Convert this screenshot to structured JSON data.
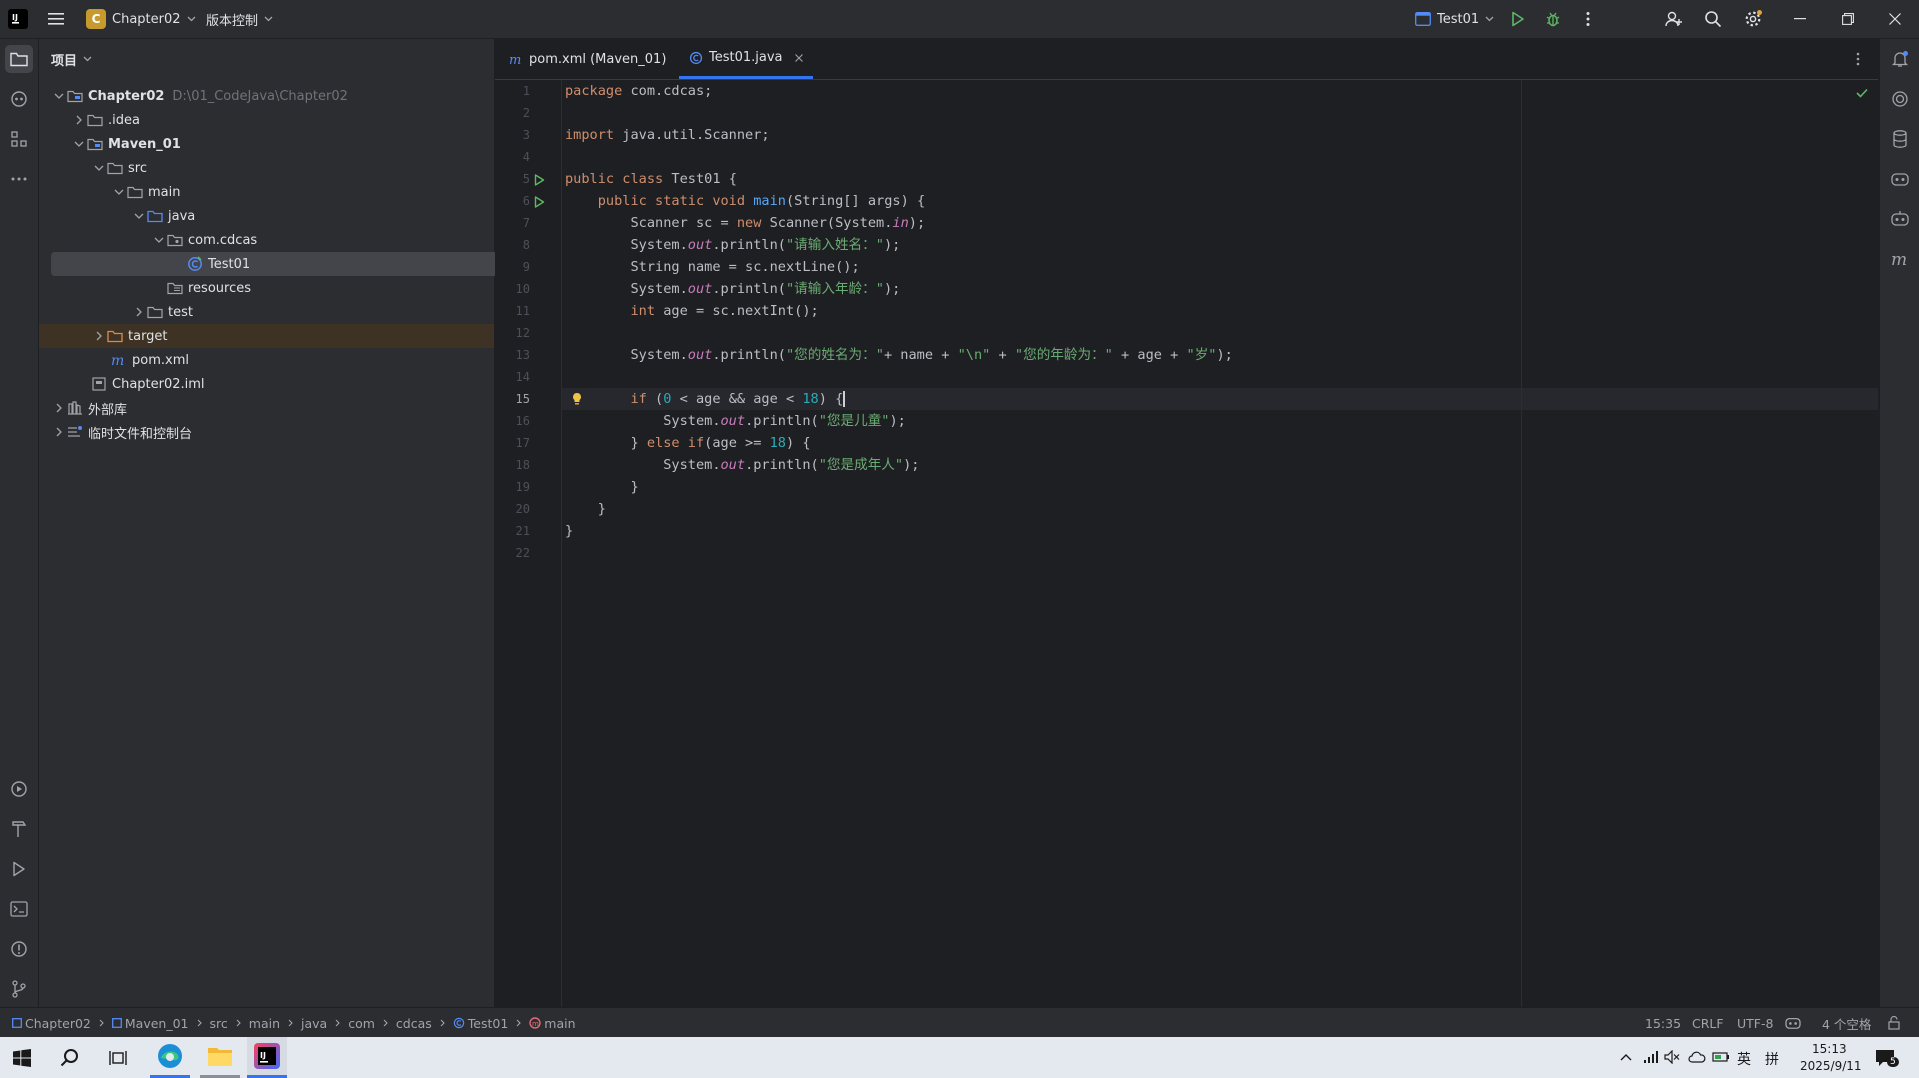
{
  "titlebar": {
    "project_initial": "C",
    "project_name": "Chapter02",
    "vcs_label": "版本控制",
    "run_config": "Test01"
  },
  "project_panel": {
    "title": "项目",
    "tree": [
      {
        "label": "Chapter02",
        "hint": "D:\\01_CodeJava\\Chapter02"
      },
      {
        "label": ".idea"
      },
      {
        "label": "Maven_01"
      },
      {
        "label": "src"
      },
      {
        "label": "main"
      },
      {
        "label": "java"
      },
      {
        "label": "com.cdcas"
      },
      {
        "label": "Test01"
      },
      {
        "label": "resources"
      },
      {
        "label": "test"
      },
      {
        "label": "target"
      },
      {
        "label": "pom.xml"
      },
      {
        "label": "Chapter02.iml"
      },
      {
        "label": "外部库"
      },
      {
        "label": "临时文件和控制台"
      }
    ]
  },
  "tabs": [
    {
      "label": "pom.xml (Maven_01)"
    },
    {
      "label": "Test01.java"
    }
  ],
  "editor": {
    "line_numbers": [
      "1",
      "2",
      "3",
      "4",
      "5",
      "6",
      "7",
      "8",
      "9",
      "10",
      "11",
      "12",
      "13",
      "14",
      "15",
      "16",
      "17",
      "18",
      "19",
      "20",
      "21",
      "22"
    ],
    "current_line": 15,
    "code": {
      "l1a": "package",
      "l1b": " com.cdcas;",
      "l3a": "import",
      "l3b": " java.util.Scanner;",
      "l5a": "public class",
      "l5b": " Test01 {",
      "l6a": "    public static void ",
      "l6b": "main",
      "l6c": "(String[] args) {",
      "l7a": "        Scanner sc = ",
      "l7b": "new",
      "l7c": " Scanner(System.",
      "l7d": "in",
      "l7e": ");",
      "l8a": "        System.",
      "l8b": "out",
      "l8c": ".println(",
      "l8d": "\"请输入姓名：\"",
      "l8e": ");",
      "l9": "        String name = sc.nextLine();",
      "l10a": "        System.",
      "l10b": "out",
      "l10c": ".println(",
      "l10d": "\"请输入年龄：\"",
      "l10e": ");",
      "l11a": "        int",
      "l11b": " age = sc.nextInt();",
      "l13a": "        System.",
      "l13b": "out",
      "l13c": ".println(",
      "l13d": "\"您的姓名为：\"",
      "l13e": "+ name + ",
      "l13f": "\"\\n\"",
      "l13g": " + ",
      "l13h": "\"您的年龄为：\"",
      "l13i": " + age + ",
      "l13j": "\"岁\"",
      "l13k": ");",
      "l15a": "        if",
      "l15b": " (",
      "l15c": "0",
      "l15d": " < age && age < ",
      "l15e": "18",
      "l15f": ") {",
      "l16a": "            System.",
      "l16b": "out",
      "l16c": ".println(",
      "l16d": "\"您是儿童\"",
      "l16e": ");",
      "l17a": "        } ",
      "l17b": "else if",
      "l17c": "(age >= ",
      "l17d": "18",
      "l17e": ") {",
      "l18a": "            System.",
      "l18b": "out",
      "l18c": ".println(",
      "l18d": "\"您是成年人\"",
      "l18e": ");",
      "l19": "        }",
      "l20": "    }",
      "l21": "}"
    }
  },
  "breadcrumbs": [
    "Chapter02",
    "Maven_01",
    "src",
    "main",
    "java",
    "com",
    "cdcas",
    "Test01",
    "main"
  ],
  "status": {
    "position": "15:35",
    "line_sep": "CRLF",
    "encoding": "UTF-8",
    "indent": "4 个空格"
  },
  "taskbar": {
    "ime1": "英",
    "ime2": "拼",
    "time": "15:13",
    "date": "2025/9/11",
    "notif_count": "5"
  },
  "colors": {
    "accent": "#3574f0",
    "run_green": "#5fb865",
    "keyword": "#cf8e6d",
    "string": "#6aab73",
    "number": "#2aacb8",
    "method": "#56a8f5"
  }
}
